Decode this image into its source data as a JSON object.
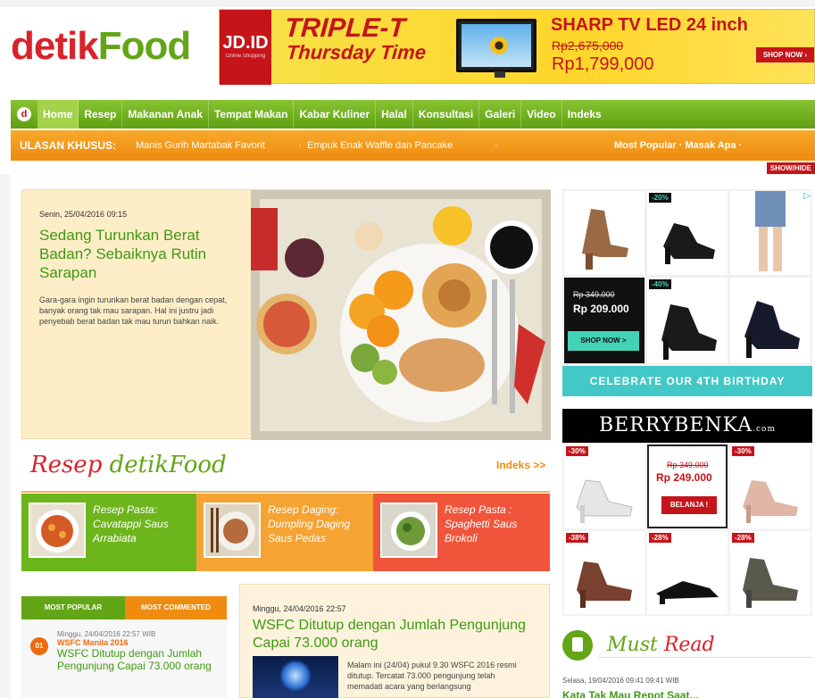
{
  "header": {
    "logo_part1": "detik",
    "logo_part2": "Food",
    "banner": {
      "jd_logo": "JD.ID",
      "jd_sub": "Online Shopping",
      "promo_line1": "TRIPLE-T",
      "promo_line2": "Thursday",
      "promo_line3": "Time",
      "product": "SHARP TV LED 24 inch",
      "old_price": "Rp2,675,000",
      "new_price": "Rp1,799,000",
      "cta": "SHOP NOW ›"
    }
  },
  "nav": {
    "home_icon": "d",
    "items": [
      "Home",
      "Resep",
      "Makanan Anak",
      "Tempat Makan",
      "Kabar Kuliner",
      "Halal",
      "Konsultasi",
      "Galeri",
      "Video",
      "Indeks"
    ]
  },
  "ulasan": {
    "label": "ULASAN KHUSUS:",
    "links": [
      "Manis Gurih Martabak Favorit",
      "Empuk Enak Waffle dan Pancake"
    ],
    "right_links": "Most Popular · Masak Apa ·",
    "sep": "·",
    "showhide": "SHOW/HIDE"
  },
  "featured": {
    "date": "Senin, 25/04/2016 09:15",
    "title": "Sedang Turunkan Berat Badan? Sebaiknya Rutin Sarapan",
    "desc": "Gara-gara ingin turunkan berat badan dengan cepat, banyak orang tak mau sarapan. Hal ini justru jadi penyebab berat badan tak mau turun bahkan naik."
  },
  "resep": {
    "title_a": "Resep",
    "title_b": "detikFood",
    "indeks": "Indeks >>",
    "cards": [
      {
        "title": "Resep Pasta: Cavatappi Saus Arrabiata"
      },
      {
        "title": "Resep Daging: Dumpling Daging Saus Pedas"
      },
      {
        "title": "Resep Pasta : Spaghetti Saus Brokoli"
      }
    ]
  },
  "popular": {
    "tab1": "MOST POPULAR",
    "tab2": "MOST COMMENTED",
    "item": {
      "num": "01",
      "date": "Minggu, 24/04/2016 22:57 WIB",
      "kicker": "WSFC Manila 2016",
      "title": "WSFC Ditutup dengan Jumlah Pengunjung Capai 73.000 orang"
    }
  },
  "wsfc": {
    "date": "Minggu, 24/04/2016 22:57",
    "title": "WSFC Ditutup dengan Jumlah Pengunjung Capai 73.000 orang",
    "text": "Malam ini (24/04) pukul 9.30 WSFC 2016 resmi ditutup. Tercatat 73.000 pengunjung telah memadati acara yang berlangsung"
  },
  "ad1": {
    "badge_top": "-20%",
    "badge_mid": "-40%",
    "old_price": "Rp 349.000",
    "new_price": "Rp 209.000",
    "shop": "SHOP NOW >",
    "celebrate": "CELEBRATE OUR 4TH BIRTHDAY",
    "adchoice": "▷"
  },
  "ad2": {
    "brand": "BERRYBENKA",
    "brand_sub": ".com",
    "badges": [
      "-30%",
      "-30%",
      "-38%",
      "-28%",
      "-28%"
    ],
    "old_price": "Rp 349.000",
    "new_price": "Rp 249.000",
    "cta": "BELANJA !"
  },
  "mustread": {
    "a": "Must",
    "b": "Read",
    "date": "Selasa, 19/04/2016 09:41 09:41 WIB",
    "headline": "Kata Tak Mau Repot Saat..."
  }
}
